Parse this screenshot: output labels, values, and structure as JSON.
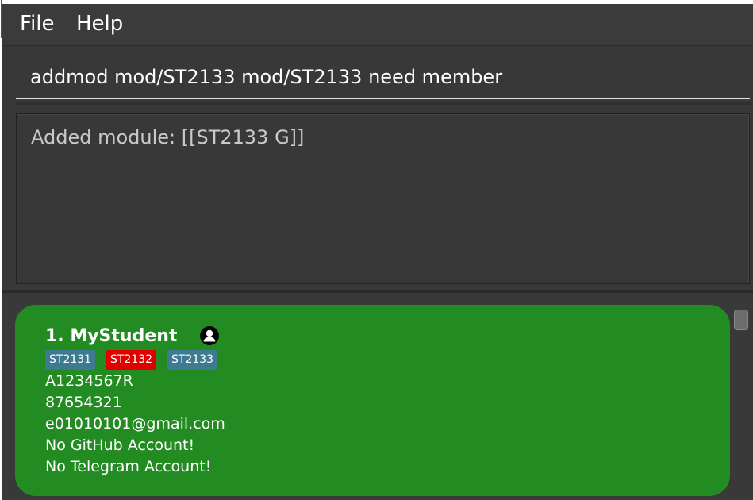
{
  "menu": {
    "file_label": "File",
    "help_label": "Help"
  },
  "command": {
    "value": "addmod mod/ST2133 mod/ST2133 need member"
  },
  "result": {
    "text": "Added module: [[ST2133 G]]"
  },
  "person_list": {
    "person": {
      "index_name": "1. MyStudent",
      "icon": "person-icon",
      "tags": [
        {
          "label": "ST2131",
          "color": "#3e7b91"
        },
        {
          "label": "ST2132",
          "color": "#e00000"
        },
        {
          "label": "ST2133",
          "color": "#3e7b91"
        }
      ],
      "student_id": "A1234567R",
      "phone": "87654321",
      "email": "e01010101@gmail.com",
      "github": "No GitHub Account!",
      "telegram": "No Telegram Account!",
      "card_color": "#228b22"
    }
  }
}
